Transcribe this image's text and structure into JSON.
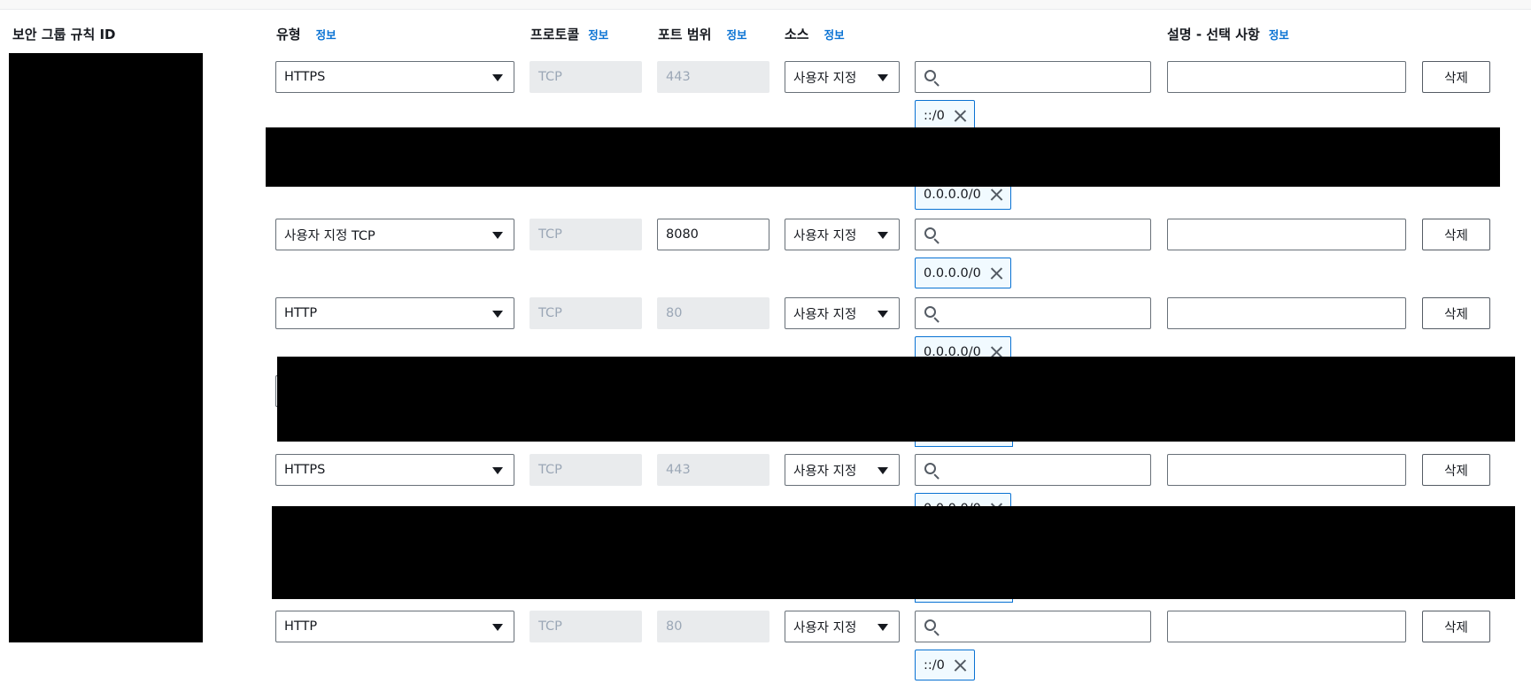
{
  "headers": {
    "rule_id": "보안 그룹 규칙 ID",
    "type": "유형",
    "protocol": "프로토콜",
    "port_range": "포트 범위",
    "source": "소스",
    "description": "설명 - 선택 사항",
    "info_link": "정보"
  },
  "delete_label": "삭제",
  "rows": [
    {
      "type": "HTTPS",
      "protocol": "TCP",
      "port": "443",
      "source": "사용자 지정",
      "search_value": "",
      "description": "",
      "token": "::/0"
    },
    {
      "type": "사용자 지정 TCP",
      "protocol": "TCP",
      "port": "8080",
      "source": "사용자 지정",
      "search_value": "",
      "description": "",
      "token": "0.0.0.0/0"
    },
    {
      "type": "HTTP",
      "protocol": "TCP",
      "port": "80",
      "source": "사용자 지정",
      "search_value": "",
      "description": "",
      "token": "0.0.0.0/0"
    },
    {
      "type": "HTTPS",
      "protocol": "TCP",
      "port": "443",
      "source": "사용자 지정",
      "search_value": "",
      "description": "",
      "token": "0.0.0.0/0"
    },
    {
      "type": "HTTP",
      "protocol": "TCP",
      "port": "80",
      "source": "사용자 지정",
      "search_value": "",
      "description": "",
      "token": "::/0"
    }
  ],
  "extra_tokens": [
    "0.0.0.0/0"
  ],
  "colors": {
    "link": "#0972d3",
    "token_border": "#0972d3",
    "token_bg": "#f1faff",
    "disabled_bg": "#e9ebed",
    "redaction": "#000000"
  }
}
